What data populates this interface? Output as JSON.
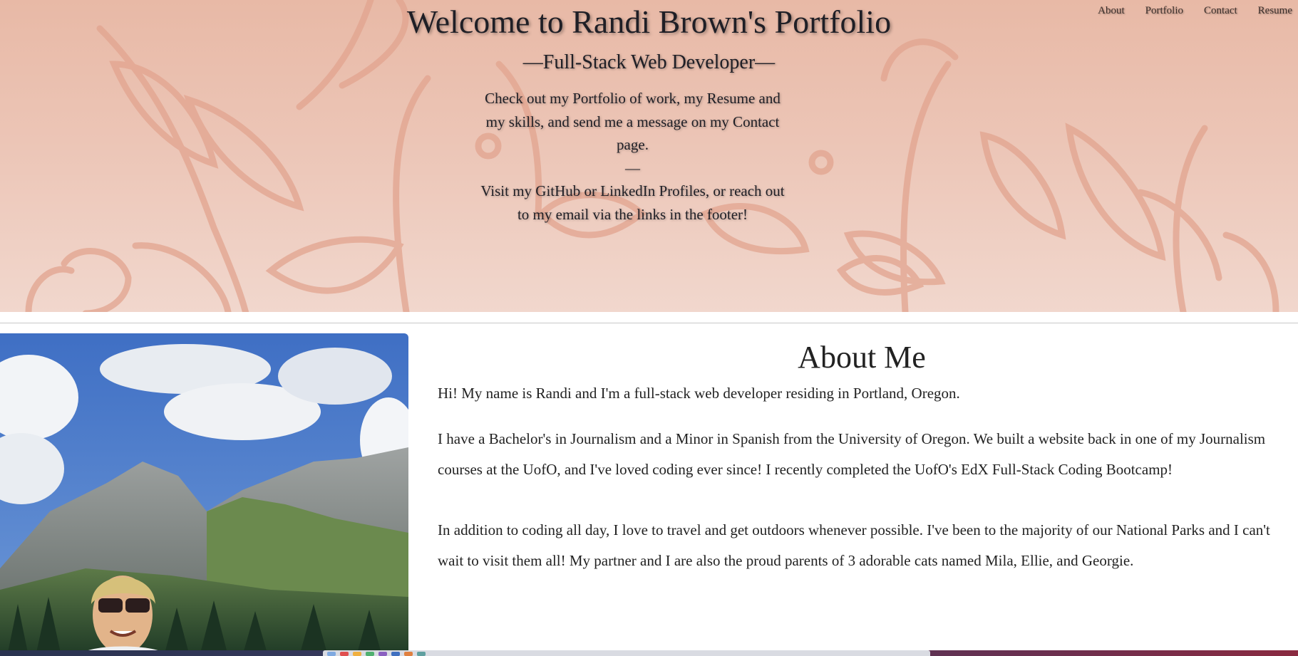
{
  "nav": {
    "items": [
      "About",
      "Portfolio",
      "Contact",
      "Resume"
    ]
  },
  "hero": {
    "title": "Welcome to Randi Brown's Portfolio",
    "subtitle": "—Full-Stack Web Developer—",
    "blurb_1": "Check out my Portfolio of work, my Resume and my skills, and send me a message on my Contact page.",
    "separator": "—",
    "blurb_2": "Visit my GitHub or LinkedIn Profiles, or reach out to my email via the links in the footer!"
  },
  "about": {
    "heading": "About Me",
    "paragraphs": [
      "Hi! My name is Randi and I'm a full-stack web developer residing in Portland, Oregon.",
      "I have a Bachelor's in Journalism and a Minor in Spanish from the University of Oregon. We built a website back in one of my Journalism courses at the UofO, and I've loved coding ever since! I recently completed the UofO's EdX Full-Stack Coding Bootcamp!",
      "In addition to coding all day, I love to travel and get outdoors whenever possible. I've been to the majority of our National Parks and I can't wait to visit them all! My partner and I are also the proud parents of 3 adorable cats named Mila, Ellie, and Georgie."
    ]
  },
  "colors": {
    "hero_top": "#e8b9a6",
    "hero_bottom": "#f1d7cd",
    "leaf_stroke": "#e2a48f",
    "text": "#222222"
  }
}
